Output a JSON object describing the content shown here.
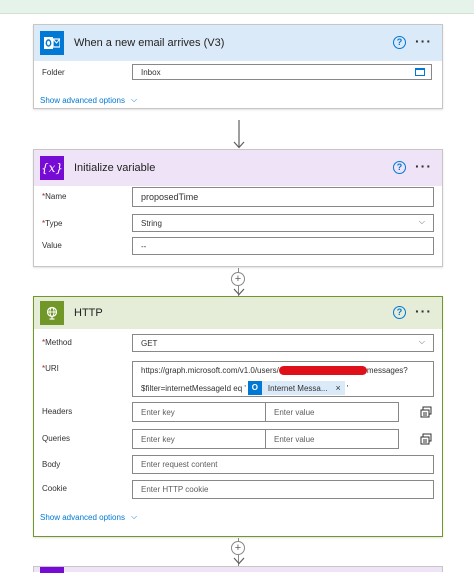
{
  "trigger": {
    "title": "When a new email arrives (V3)",
    "icon": "outlook-icon",
    "color": "#0078d4",
    "folder_label": "Folder",
    "folder_value": "Inbox",
    "advanced_label": "Show advanced options"
  },
  "init_var": {
    "title": "Initialize variable",
    "icon": "variable-icon",
    "color": "#770bd6",
    "name_label": "Name",
    "name_value": "proposedTime",
    "type_label": "Type",
    "type_value": "String",
    "value_label": "Value",
    "value_value": "--"
  },
  "http": {
    "title": "HTTP",
    "icon": "globe-icon",
    "color": "#709727",
    "method_label": "Method",
    "method_value": "GET",
    "uri_label": "URI",
    "uri_line1_prefix": "https://graph.microsoft.com/v1.0/users/",
    "uri_line1_suffix": "messages?",
    "uri_line2_prefix": "$filter=internetMessageId eq '",
    "uri_token_label": "Internet Messa...",
    "uri_token_close": "×",
    "uri_line2_suffix": "'",
    "headers_label": "Headers",
    "queries_label": "Queries",
    "key_placeholder": "Enter key",
    "value_placeholder": "Enter value",
    "body_label": "Body",
    "body_placeholder": "Enter request content",
    "cookie_label": "Cookie",
    "cookie_placeholder": "Enter HTTP cookie",
    "advanced_label": "Show advanced options"
  },
  "common": {
    "help_glyph": "?",
    "more_glyph": "···",
    "required_mark": "*",
    "plus_glyph": "+",
    "chevron": "⌵"
  }
}
